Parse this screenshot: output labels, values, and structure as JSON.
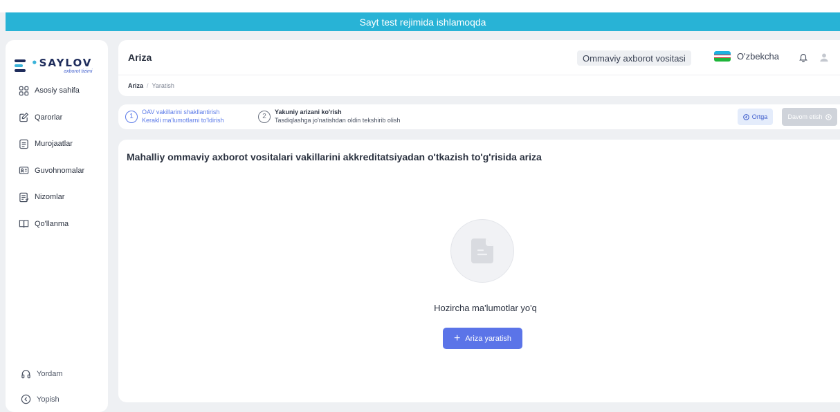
{
  "banner": {
    "text": "Sayt test rejimida ishlamoqda"
  },
  "logo": {
    "title": "SAYLOV",
    "subtitle": "axborot tizimi"
  },
  "sidebar": {
    "items": [
      {
        "label": "Asosiy sahifa",
        "icon": "grid-icon"
      },
      {
        "label": "Qarorlar",
        "icon": "edit-icon"
      },
      {
        "label": "Murojaatlar",
        "icon": "document-list-icon"
      },
      {
        "label": "Guvohnomalar",
        "icon": "id-card-icon"
      },
      {
        "label": "Nizomlar",
        "icon": "regulation-icon"
      },
      {
        "label": "Qo'llanma",
        "icon": "book-icon"
      }
    ],
    "bottom": [
      {
        "label": "Yordam",
        "icon": "headphones-icon"
      },
      {
        "label": "Yopish",
        "icon": "chevron-left-circle-icon"
      }
    ]
  },
  "header": {
    "title": "Ariza",
    "organization": "Ommaviy axborot vositasi",
    "language": "O'zbekcha"
  },
  "breadcrumb": {
    "current": "Ariza",
    "separator": "/",
    "last": "Yaratish"
  },
  "steps": [
    {
      "number": "1",
      "title": "OAV vakillarini shakllantirish",
      "subtitle": "Kerakli ma'lumotlarni to'ldirish"
    },
    {
      "number": "2",
      "title": "Yakuniy arizani ko'rish",
      "subtitle": "Tasdiqlashga jo'natishdan oldin tekshirib olish"
    }
  ],
  "buttons": {
    "back": "Ortga",
    "next": "Davom etish",
    "create": "Ariza yaratish"
  },
  "content": {
    "title": "Mahalliy ommaviy axborot vositalari vakillarini akkreditatsiyadan o'tkazish to'g'risida ariza",
    "empty_text": "Hozircha ma'lumotlar yo'q"
  },
  "colors": {
    "banner": "#28b3d6",
    "accent": "#5b74e8",
    "active_step": "#5b7ae8"
  }
}
